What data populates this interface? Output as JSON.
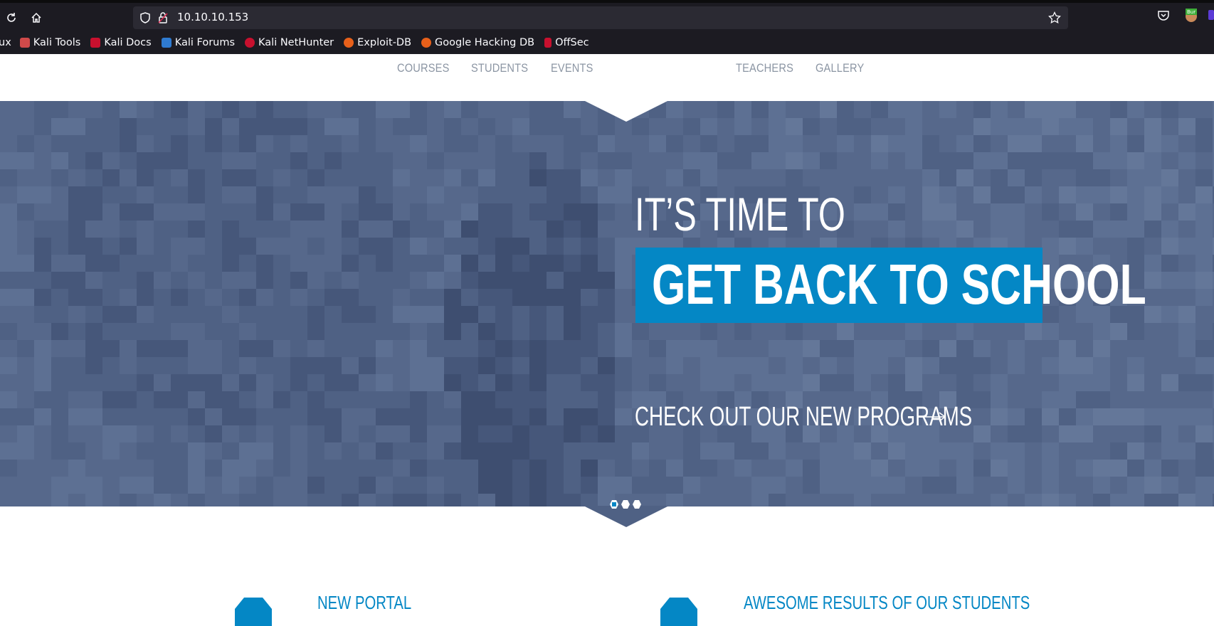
{
  "browser": {
    "url": "10.10.10.153",
    "bookmarks": [
      {
        "label": "ux",
        "color": ""
      },
      {
        "label": "Kali Tools",
        "color": "#d04a4a"
      },
      {
        "label": "Kali Docs",
        "color": "#c8102e"
      },
      {
        "label": "Kali Forums",
        "color": "#2f7bd1"
      },
      {
        "label": "Kali NetHunter",
        "color": "#c8102e"
      },
      {
        "label": "Exploit-DB",
        "color": "#e8601a"
      },
      {
        "label": "Google Hacking DB",
        "color": "#e8601a"
      },
      {
        "label": "OffSec",
        "color": "#c8102e"
      }
    ],
    "extension_badge": "Bur"
  },
  "site": {
    "nav": {
      "courses": "COURSES",
      "students": "STUDENTS",
      "events": "EVENTS",
      "teachers": "TEACHERS",
      "gallery": "GALLERY"
    },
    "hero": {
      "pre_title": "IT’S TIME TO",
      "main_title": "GET BACK TO SCHOOL",
      "cta": "CHECK OUT OUR NEW PROGRAMS",
      "slides": 3,
      "active_slide": 1
    },
    "features": [
      {
        "title": "NEW PORTAL"
      },
      {
        "title": "AWESOME RESULTS OF OUR STUDENTS"
      }
    ],
    "colors": {
      "accent": "#0487c5",
      "hero_bg": "#4f6184",
      "nav_text": "#8b95a3"
    }
  }
}
